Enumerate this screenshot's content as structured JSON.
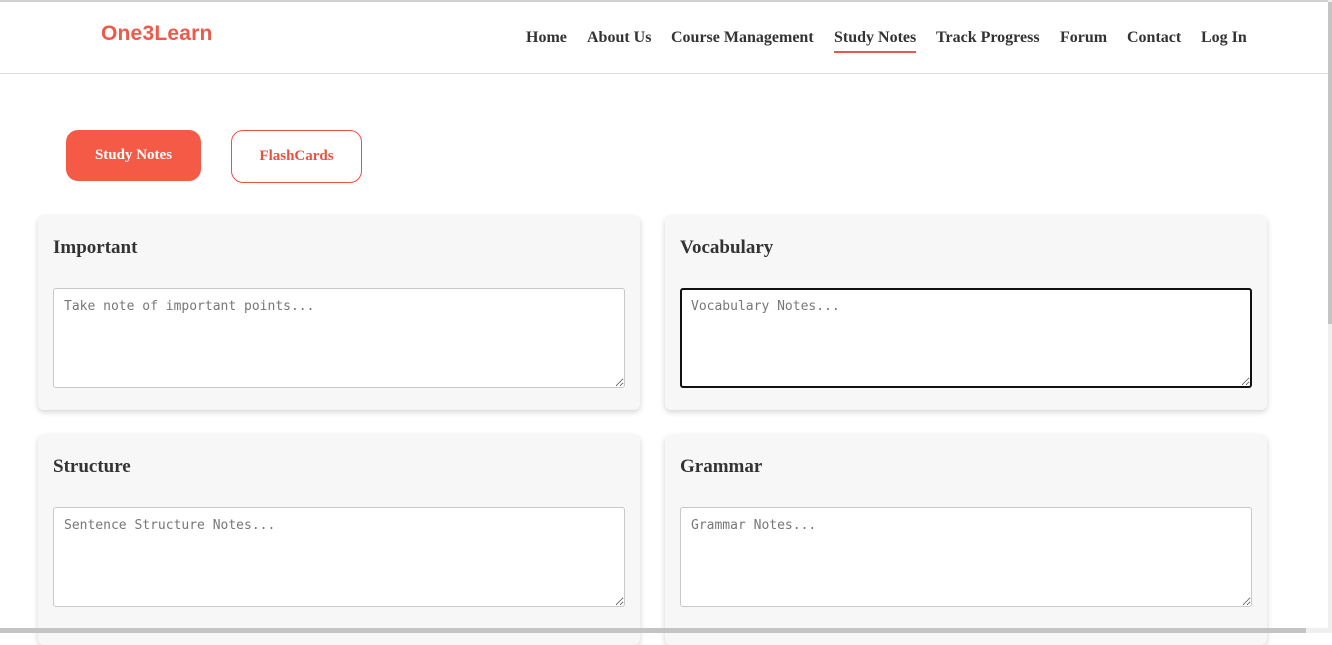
{
  "brand": {
    "name": "One3Learn",
    "accent": "#ee5a4a"
  },
  "nav": {
    "items": [
      {
        "label": "Home"
      },
      {
        "label": "About Us"
      },
      {
        "label": "Course Management"
      },
      {
        "label": "Study Notes"
      },
      {
        "label": "Track Progress"
      },
      {
        "label": "Forum"
      },
      {
        "label": "Contact"
      },
      {
        "label": "Log In"
      }
    ],
    "active": "Study Notes"
  },
  "tabs": [
    {
      "label": "Study Notes",
      "selected": true
    },
    {
      "label": "FlashCards",
      "selected": false
    }
  ],
  "cards": [
    {
      "title": "Important",
      "placeholder": "Take note of important points..."
    },
    {
      "title": "Vocabulary",
      "placeholder": "Vocabulary Notes...",
      "focused": true
    },
    {
      "title": "Structure",
      "placeholder": "Sentence Structure Notes..."
    },
    {
      "title": "Grammar",
      "placeholder": "Grammar Notes..."
    }
  ]
}
